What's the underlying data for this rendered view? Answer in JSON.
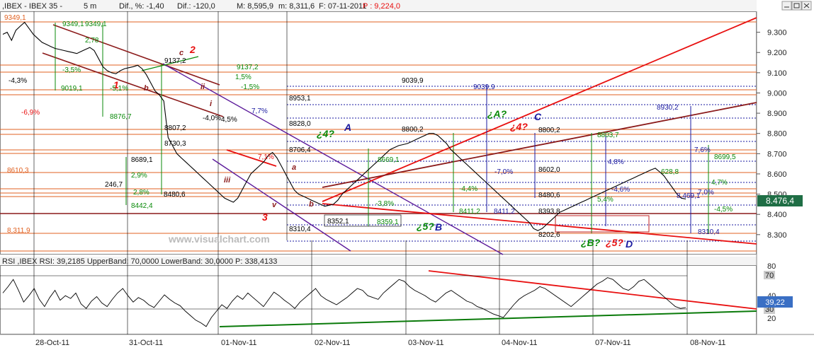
{
  "header": {
    "instrument": ",IBEX - IBEX 35 -",
    "interval": "5 m",
    "dif_pct": "Dif., %: -1,40",
    "dif_abs": "Dif.: -120,0",
    "high": "M: 8,595,9",
    "low": "m: 8,311,6",
    "close": "F: 07-11-2011",
    "prev": "P : 9,224,0"
  },
  "colors": {
    "price": "#000000",
    "red": "#e81010",
    "darkred": "#8b1a1a",
    "purple": "#5b1a9a",
    "green": "#0a8a0a",
    "blue": "#1a1aa0",
    "orange": "#d06010",
    "badge": "#1f6e45"
  },
  "price_axis": {
    "ticks": [
      "9.300",
      "9.200",
      "9.100",
      "9.000",
      "8.900",
      "8.800",
      "8.700",
      "8.600",
      "8.500",
      "8.400",
      "8.300"
    ],
    "last_price": "8.476,4"
  },
  "rsi_panel": {
    "title": "RSI ,IBEX RSI: 39,2185 UpperBand: 70,0000 LowerBand: 30,0000 P: 338,4133",
    "ticks": [
      "80",
      "70",
      "40",
      "30",
      "20"
    ],
    "upper_label": "70",
    "lower_label": "30",
    "value_label": "39,22"
  },
  "date_axis": {
    "labels": [
      "28-Oct-11",
      "31-Oct-11",
      "01-Nov-11",
      "02-Nov-11",
      "03-Nov-11",
      "04-Nov-11",
      "07-Nov-11",
      "08-Nov-11"
    ]
  },
  "watermark": "www.visualchart.com",
  "annotations": {
    "wave_1": "1",
    "wave_2": "2",
    "wave_3": "3",
    "wave_a1": "a",
    "wave_b1": "b",
    "wave_c1": "c",
    "wave_i": "i",
    "wave_ii": "ii",
    "wave_iii": "iii",
    "wave_v": "v",
    "wave_a2": "a",
    "wave_b2": "b",
    "A": "A",
    "q4": "¿4?",
    "qA": "¿A?",
    "q4red": "¿4?",
    "C": "C",
    "q5B": "¿5?",
    "B": "B",
    "qB": "¿B?",
    "q5D": "¿5?",
    "D": "D"
  },
  "price_labels": {
    "p9349_1": "9349,1",
    "p9349_1b": "9349,1",
    "p9349_1c": "9349,1",
    "p9137_2": "9137,2",
    "p9137_2b": "9137,2",
    "p9039_9": "9039,9",
    "p9039_9b": "9039,9",
    "p8953_1": "8953,1",
    "p8930_2": "8930,2",
    "p8828_0": "8828,0",
    "p8800_2": "8800,2",
    "p8800_2b": "8800,2",
    "p8803_7": "8803,7",
    "p8807_2": "8807,2",
    "p8706_4": "8706,4",
    "p8699_5": "8699,5",
    "p8689_1": "8689,1",
    "p8610_3": "8610,3",
    "p8602_0": "8602,0",
    "p8480_6": "8480,6",
    "p8480_6b": "8480,6",
    "p8442_4": "8442,4",
    "p8411_2": "8411,2",
    "p8411_2b": "8411,2",
    "p8393_8": "8393,8",
    "p8359_1": "8359,1",
    "p8352_1": "8352,1",
    "p8310_4": "8310,4",
    "p8310_4b": "8310,4",
    "p8311_9": "8,311,9",
    "p8202_6": "8202,6",
    "p9019_1": "9019,1",
    "p8876_7": "8876,7",
    "p8730_3": "8730,3",
    "p628_8": "628,8",
    "p246_7": "246,7",
    "p8669_1": "8669,1",
    "p8469_1": "8,469,1"
  },
  "pct_labels": {
    "m3_5": "-3,5%",
    "m5_1": "-5,1%",
    "m6_9": "-6,9%",
    "m4_3": "-4,3%",
    "m4_0": "-4,0%",
    "p4_5": "4,5%",
    "p7_7": "7,7%",
    "p1_5": "1,5%",
    "m1_5": "-1,5%",
    "p2_9": "2,9%",
    "p2_8": "2,8%",
    "m3_8": "-3,8%",
    "m4_4": "-4,4%",
    "m7_0": "-7,0%",
    "p4_8": "4,8%",
    "p5_4": "5,4%",
    "m4_6": "-4,6%",
    "p7_6": "7,6%",
    "p4_7": "4,7%",
    "m4_5": "-4,5%",
    "p7_0": "7,0%",
    "p2_78": "2,78",
    "p7_1": "7,1%"
  },
  "chart_data": {
    "type": "line",
    "title": "",
    "instrument": "IBEX 35",
    "interval_minutes": 5,
    "ylim": [
      8205,
      9400
    ],
    "y_ticks": [
      9300,
      9200,
      9100,
      9000,
      8900,
      8800,
      8700,
      8600,
      8500,
      8400,
      8300
    ],
    "x_dates": [
      "28-Oct-11",
      "31-Oct-11",
      "01-Nov-11",
      "02-Nov-11",
      "03-Nov-11",
      "04-Nov-11",
      "07-Nov-11",
      "08-Nov-11"
    ],
    "series": [
      {
        "name": "IBEX",
        "values": [
          9290,
          9300,
          9260,
          9310,
          9330,
          9349,
          9320,
          9290,
          9270,
          9250,
          9240,
          9230,
          9220,
          9215,
          9210,
          9205,
          9200,
          9195,
          9205,
          9215,
          9225,
          9210,
          9170,
          9130,
          9110,
          9100,
          9095,
          9110,
          9120,
          9125,
          9130,
          9137,
          9120,
          9090,
          9050,
          9010,
          8990,
          8960,
          8780,
          8740,
          8700,
          8680,
          8660,
          8640,
          8620,
          8600,
          8580,
          8560,
          8540,
          8520,
          8500,
          8480,
          8470,
          8460,
          8480,
          8520,
          8560,
          8600,
          8620,
          8640,
          8660,
          8690,
          8706,
          8680,
          8640,
          8600,
          8560,
          8520,
          8500,
          8490,
          8480,
          8470,
          8460,
          8450,
          8440,
          8445,
          8450,
          8470,
          8500,
          8520,
          8540,
          8560,
          8580,
          8600,
          8620,
          8640,
          8660,
          8680,
          8700,
          8720,
          8730,
          8740,
          8745,
          8750,
          8760,
          8770,
          8780,
          8790,
          8800,
          8800,
          8790,
          8770,
          8750,
          8720,
          8700,
          8680,
          8660,
          8640,
          8620,
          8600,
          8580,
          8560,
          8540,
          8520,
          8500,
          8480,
          8460,
          8440,
          8420,
          8400,
          8380,
          8360,
          8330,
          8320,
          8330,
          8350,
          8370,
          8390,
          8410,
          8420,
          8430,
          8440,
          8450,
          8460,
          8470,
          8480,
          8490,
          8500,
          8510,
          8520,
          8530,
          8540,
          8550,
          8560,
          8570,
          8580,
          8590,
          8600,
          8610,
          8620,
          8628,
          8610,
          8590,
          8560,
          8530,
          8500,
          8480,
          8476
        ]
      }
    ],
    "rsi": {
      "name": "RSI",
      "last": 39.2185,
      "upper_band": 70,
      "lower_band": 30,
      "ylim": [
        10,
        85
      ],
      "values": [
        55,
        62,
        70,
        58,
        45,
        52,
        60,
        48,
        40,
        50,
        58,
        47,
        52,
        49,
        55,
        43,
        38,
        46,
        51,
        44,
        40,
        48,
        55,
        60,
        52,
        45,
        50,
        47,
        42,
        39,
        46,
        53,
        48,
        44,
        41,
        35,
        30,
        25,
        22,
        18,
        28,
        35,
        42,
        38,
        46,
        52,
        48,
        55,
        50,
        45,
        40,
        48,
        56,
        52,
        47,
        43,
        38,
        45,
        50,
        55,
        60,
        52,
        48,
        45,
        42,
        46,
        50,
        55,
        60,
        58,
        52,
        50,
        48,
        55,
        60,
        65,
        70,
        68,
        62,
        58,
        55,
        52,
        48,
        45,
        50,
        55,
        58,
        54,
        50,
        46,
        44,
        40,
        38,
        35,
        32,
        30,
        28,
        35,
        42,
        48,
        52,
        55,
        58,
        62,
        60,
        56,
        52,
        48,
        44,
        40,
        45,
        50,
        55,
        60,
        65,
        68,
        72,
        70,
        65,
        60,
        58,
        62,
        68,
        70,
        65,
        60,
        55,
        50,
        45,
        40,
        38,
        39
      ]
    }
  }
}
